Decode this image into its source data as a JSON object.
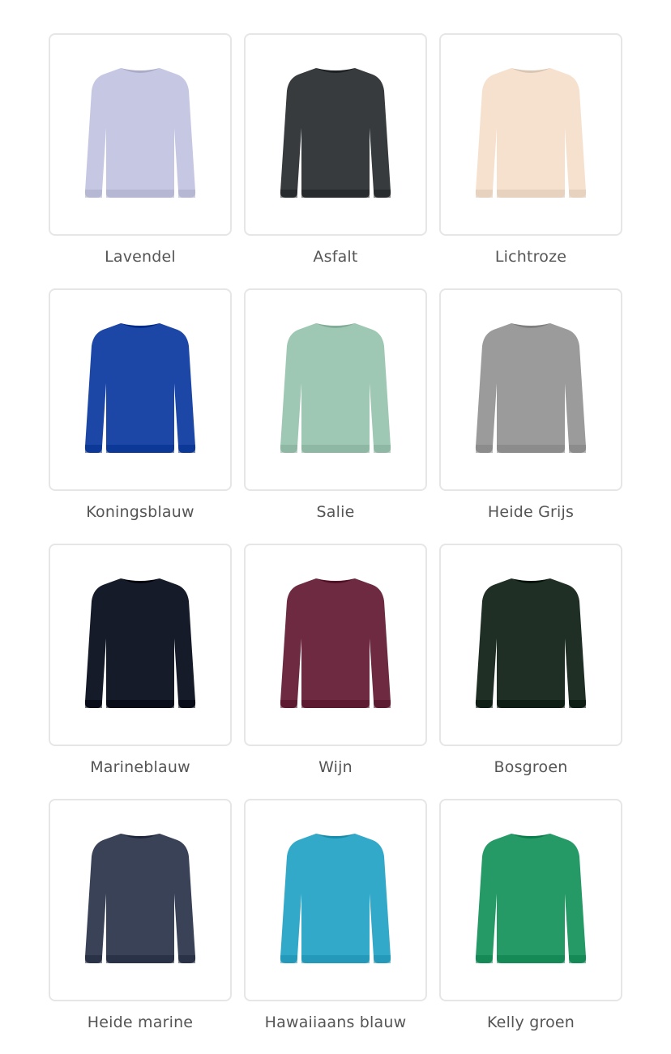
{
  "colors": [
    {
      "label": "Lavendel",
      "hex": "#c6c7e3",
      "icon": "sweatshirt-icon"
    },
    {
      "label": "Asfalt",
      "hex": "#383b3d",
      "icon": "sweatshirt-icon"
    },
    {
      "label": "Lichtroze",
      "hex": "#f6e1cf",
      "icon": "sweatshirt-icon"
    },
    {
      "label": "Koningsblauw",
      "hex": "#1c47a7",
      "icon": "sweatshirt-icon"
    },
    {
      "label": "Salie",
      "hex": "#9ec8b4",
      "icon": "sweatshirt-icon"
    },
    {
      "label": "Heide Grijs",
      "hex": "#9b9b9b",
      "icon": "sweatshirt-icon"
    },
    {
      "label": "Marineblauw",
      "hex": "#151b29",
      "icon": "sweatshirt-icon"
    },
    {
      "label": "Wijn",
      "hex": "#6d2a40",
      "icon": "sweatshirt-icon"
    },
    {
      "label": "Bosgroen",
      "hex": "#1f2f25",
      "icon": "sweatshirt-icon"
    },
    {
      "label": "Heide marine",
      "hex": "#3a4258",
      "icon": "sweatshirt-icon"
    },
    {
      "label": "Hawaiiaans blauw",
      "hex": "#33a9c9",
      "icon": "sweatshirt-icon"
    },
    {
      "label": "Kelly groen",
      "hex": "#259a66",
      "icon": "sweatshirt-icon"
    }
  ]
}
